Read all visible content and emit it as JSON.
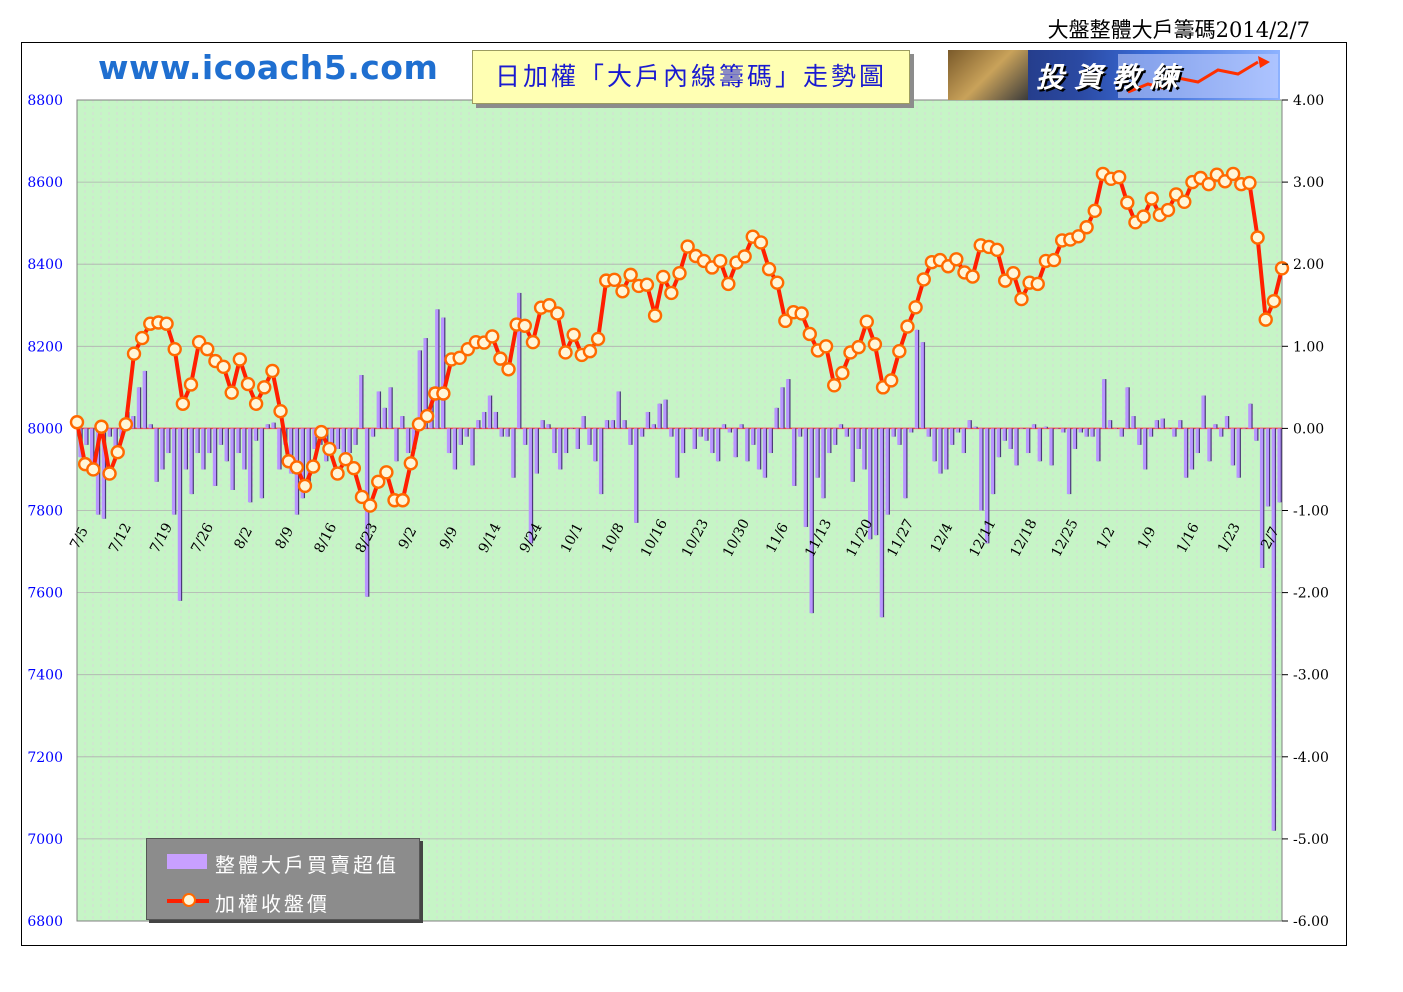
{
  "header": {
    "page_title": "大盤整體大戶籌碼2014/2/7",
    "site_url": "www.icoach5.com",
    "chart_title": "日加權「大戶內線籌碼」走勢圖",
    "logo_text": "投資教練"
  },
  "colors": {
    "plot_background": "#c6f5c6",
    "grid": "#d8d8d8",
    "bars": "#b896ff",
    "bar_shadow": "#4a3a78",
    "line": "#ff2000",
    "marker_fill": "#fff6d8",
    "marker_edge": "#ff6a00",
    "zero_line": "#ff4040",
    "left_axis_text": "#0000ff",
    "right_axis_text": "#000000",
    "date_text": "#000000"
  },
  "legend": {
    "bar_label": "整體大戶買賣超值",
    "line_label": "加權收盤價"
  },
  "chart_data": {
    "type": "bar+line",
    "left_axis": {
      "ylim": [
        6800,
        8800
      ],
      "ticks": [
        "8800",
        "8600",
        "8400",
        "8200",
        "8000",
        "7800",
        "7600",
        "7400",
        "7200",
        "7000",
        "6800"
      ]
    },
    "right_axis": {
      "ylim": [
        -6,
        4
      ],
      "ticks": [
        "4.00",
        "3.00",
        "2.00",
        "1.00",
        "0.00",
        "-1.00",
        "-2.00",
        "-3.00",
        "-4.00",
        "-5.00",
        "-6.00"
      ]
    },
    "date_labels": [
      "7/5",
      "7/12",
      "7/19",
      "7/26",
      "8/2",
      "8/9",
      "8/16",
      "8/23",
      "9/2",
      "9/9",
      "9/14",
      "9/24",
      "10/1",
      "10/8",
      "10/16",
      "10/23",
      "10/30",
      "11/6",
      "11/13",
      "11/20",
      "11/27",
      "12/4",
      "12/11",
      "12/18",
      "12/25",
      "1/2",
      "1/9",
      "1/16",
      "1/23",
      "2/7"
    ],
    "grid": true,
    "legend_position": "bottom-left",
    "series": [
      {
        "name": "加權收盤價",
        "axis": "left",
        "type": "line",
        "values": [
          8015,
          7913,
          7900,
          8004,
          7890,
          7942,
          8010,
          8182,
          8220,
          8255,
          8258,
          8255,
          8193,
          8060,
          8107,
          8210,
          8193,
          8164,
          8150,
          8087,
          8168,
          8108,
          8060,
          8100,
          8140,
          8042,
          7920,
          7905,
          7860,
          7907,
          7991,
          7950,
          7890,
          7925,
          7903,
          7833,
          7812,
          7870,
          7893,
          7825,
          7825,
          7915,
          8010,
          8030,
          8085,
          8085,
          8168,
          8172,
          8193,
          8210,
          8209,
          8224,
          8170,
          8144,
          8253,
          8250,
          8210,
          8294,
          8300,
          8280,
          8185,
          8228,
          8179,
          8188,
          8218,
          8360,
          8362,
          8334,
          8374,
          8347,
          8350,
          8275,
          8369,
          8330,
          8378,
          8443,
          8420,
          8408,
          8392,
          8408,
          8352,
          8404,
          8419,
          8467,
          8453,
          8388,
          8355,
          8262,
          8283,
          8280,
          8230,
          8190,
          8200,
          8105,
          8135,
          8185,
          8198,
          8260,
          8205,
          8100,
          8117,
          8188,
          8248,
          8295,
          8363,
          8405,
          8410,
          8395,
          8412,
          8380,
          8370,
          8446,
          8442,
          8435,
          8360,
          8378,
          8315,
          8355,
          8352,
          8408,
          8410,
          8458,
          8460,
          8468,
          8490,
          8530,
          8620,
          8608,
          8612,
          8550,
          8502,
          8516,
          8560,
          8520,
          8532,
          8570,
          8552,
          8600,
          8610,
          8595,
          8618,
          8602,
          8620,
          8595,
          8598,
          8465,
          8265,
          8310,
          8390
        ]
      },
      {
        "name": "整體大戶買賣超值",
        "axis": "right",
        "type": "bar",
        "values": [
          -0.35,
          -0.2,
          -0.55,
          -1.05,
          -1.1,
          -0.1,
          -0.3,
          -0.1,
          0.2,
          0.15,
          0.5,
          0.7,
          0.05,
          -0.65,
          -0.5,
          -0.3,
          -1.05,
          -2.1,
          -0.5,
          -0.8,
          -0.3,
          -0.5,
          -0.3,
          -0.7,
          -0.2,
          -0.4,
          -0.75,
          -0.3,
          -0.5,
          -0.9,
          -0.15,
          -0.85,
          0.05,
          0.07,
          -0.5,
          -0.2,
          -0.55,
          -1.05,
          -0.85,
          -0.75,
          -0.25,
          -0.2,
          -0.4,
          -0.3,
          -0.25,
          -0.4,
          -0.3,
          -0.2,
          0.65,
          -2.05,
          -0.1,
          0.45,
          0.25,
          0.5,
          -0.4,
          0.15,
          -0.3,
          -0.25,
          0.95,
          1.1,
          0.5,
          1.45,
          1.35,
          -0.3,
          -0.5,
          -0.2,
          -0.1,
          -0.45,
          0.1,
          0.2,
          0.4,
          0.2,
          -0.1,
          -0.1,
          -0.6,
          1.65,
          -0.2,
          -1.4,
          -0.55,
          0.1,
          0.05,
          -0.3,
          -0.5,
          -0.3,
          0.0,
          -0.25,
          0.15,
          -0.2,
          -0.4,
          -0.8,
          0.1,
          0.1,
          0.45,
          0.1,
          -0.2,
          -1.15,
          -0.1,
          0.2,
          0.05,
          0.3,
          0.35,
          -0.1,
          -0.6,
          -0.3,
          0.0,
          -0.25,
          -0.1,
          -0.15,
          -0.3,
          -0.4,
          0.05,
          -0.05,
          -0.35,
          0.05,
          -0.4,
          -0.2,
          -0.5,
          -0.6,
          -0.3,
          0.25,
          0.5,
          0.6,
          -0.7,
          -0.1,
          -1.2,
          -2.25,
          -0.6,
          -0.85,
          -0.3,
          -0.2,
          0.05,
          -0.1,
          -0.65,
          -0.25,
          -0.5,
          -1.35,
          -1.3,
          -2.3,
          -1.05,
          -0.1,
          -0.2,
          -0.85,
          -0.05,
          1.2,
          1.05,
          -0.1,
          -0.4,
          -0.55,
          -0.5,
          -0.2,
          -0.05,
          -0.3,
          0.1,
          0.02,
          -1.0,
          -1.4,
          -0.8,
          -0.35,
          -0.15,
          -0.25,
          -0.45,
          0.0,
          -0.3,
          0.05,
          -0.4,
          0.02,
          -0.45,
          0.0,
          -0.05,
          -0.8,
          -0.25,
          -0.05,
          -0.1,
          -0.1,
          -0.4,
          0.6,
          0.1,
          0.0,
          -0.1,
          0.5,
          0.15,
          -0.2,
          -0.5,
          -0.1,
          0.1,
          0.12,
          0.0,
          -0.1,
          0.1,
          -0.6,
          -0.5,
          -0.3,
          0.4,
          -0.4,
          0.05,
          -0.1,
          0.15,
          -0.45,
          -0.6,
          0.0,
          0.3,
          -0.15,
          -1.7,
          -0.95,
          -4.9,
          -0.9
        ]
      }
    ]
  }
}
